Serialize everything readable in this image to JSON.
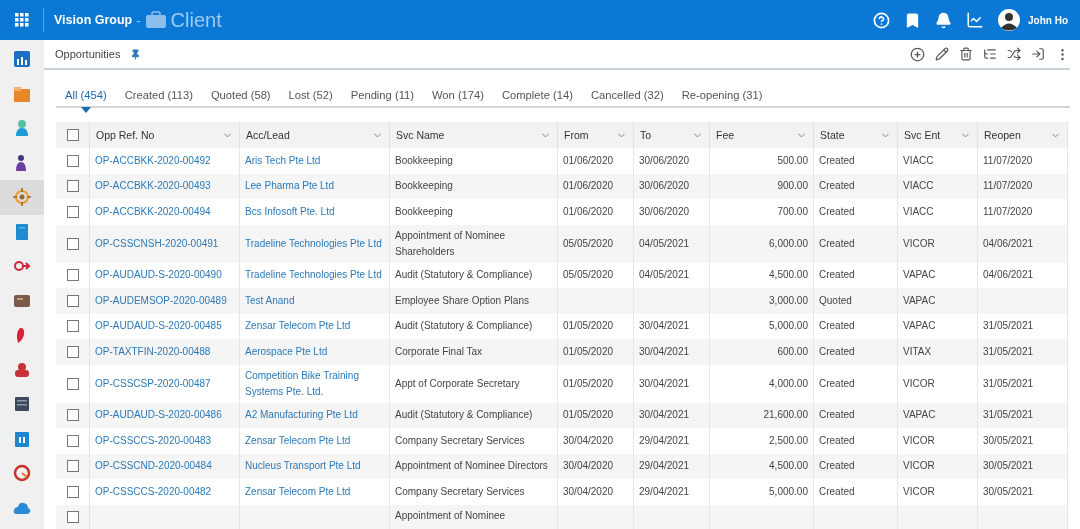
{
  "app_bar": {
    "org": "Vision Group",
    "separator": "-",
    "module": "Client",
    "user": "John Ho"
  },
  "sidebar": {
    "items": [
      {
        "selected": false
      },
      {
        "selected": false
      },
      {
        "selected": false
      },
      {
        "selected": false
      },
      {
        "selected": true
      },
      {
        "selected": false
      },
      {
        "selected": false
      },
      {
        "selected": false
      },
      {
        "selected": false
      },
      {
        "selected": false
      },
      {
        "selected": false
      },
      {
        "selected": false
      },
      {
        "selected": false
      },
      {
        "selected": false
      }
    ]
  },
  "breadcrumb": {
    "title": "Opportunities"
  },
  "tabs": [
    {
      "label": "All (454)",
      "selected": true
    },
    {
      "label": "Created (113)",
      "selected": false
    },
    {
      "label": "Quoted (58)",
      "selected": false
    },
    {
      "label": "Lost (52)",
      "selected": false
    },
    {
      "label": "Pending (11)",
      "selected": false
    },
    {
      "label": "Won (174)",
      "selected": false
    },
    {
      "label": "Complete (14)",
      "selected": false
    },
    {
      "label": "Cancelled (32)",
      "selected": false
    },
    {
      "label": "Re-opening (31)",
      "selected": false
    }
  ],
  "table": {
    "all_checked": false,
    "columns": [
      "Opp Ref. No",
      "Acc/Lead",
      "Svc Name",
      "From",
      "To",
      "Fee",
      "State",
      "Svc Ent",
      "Reopen"
    ],
    "rows": [
      {
        "checked": false,
        "cells": [
          "OP-ACCBKK-2020-00492",
          "Aris Tech Pte Ltd",
          "Bookkeeping",
          "01/06/2020",
          "30/06/2020",
          "500.00",
          "Created",
          "VIACC",
          "11/07/2020"
        ]
      },
      {
        "checked": false,
        "cells": [
          "OP-ACCBKK-2020-00493",
          "Lee Pharma Pte Ltd",
          "Bookkeeping",
          "01/06/2020",
          "30/06/2020",
          "900.00",
          "Created",
          "VIACC",
          "11/07/2020"
        ]
      },
      {
        "checked": false,
        "cells": [
          "OP-ACCBKK-2020-00494",
          "Bcs Infosoft Pte. Ltd",
          "Bookkeeping",
          "01/06/2020",
          "30/06/2020",
          "700.00",
          "Created",
          "VIACC",
          "11/07/2020"
        ]
      },
      {
        "checked": false,
        "cells": [
          "OP-CSSCNSH-2020-00491",
          "Tradeline Technologies Pte Ltd",
          "Appointment of Nominee Shareholders",
          "05/05/2020",
          "04/05/2021",
          "6,000.00",
          "Created",
          "VICOR",
          "04/06/2021"
        ]
      },
      {
        "checked": false,
        "cells": [
          "OP-AUDAUD-S-2020-00490",
          "Tradeline Technologies Pte Ltd",
          "Audit (Statutory & Compliance)",
          "05/05/2020",
          "04/05/2021",
          "4,500.00",
          "Created",
          "VAPAC",
          "04/06/2021"
        ]
      },
      {
        "checked": false,
        "cells": [
          "OP-AUDEMSOP-2020-00489",
          "Test Anand",
          "Employee Share Option Plans",
          "",
          "",
          "3,000.00",
          "Quoted",
          "VAPAC",
          ""
        ]
      },
      {
        "checked": false,
        "cells": [
          "OP-AUDAUD-S-2020-00485",
          "Zensar Telecom Pte Ltd",
          "Audit (Statutory & Compliance)",
          "01/05/2020",
          "30/04/2021",
          "5,000.00",
          "Created",
          "VAPAC",
          "31/05/2021"
        ]
      },
      {
        "checked": false,
        "cells": [
          "OP-TAXTFIN-2020-00488",
          "Aerospace Pte Ltd",
          "Corporate Final Tax",
          "01/05/2020",
          "30/04/2021",
          "600.00",
          "Created",
          "VITAX",
          "31/05/2021"
        ]
      },
      {
        "checked": false,
        "cells": [
          "OP-CSSCSP-2020-00487",
          "Competition Bike Training Systems Pte. Ltd.",
          "Appt of Corporate Secretary",
          "01/05/2020",
          "30/04/2021",
          "4,000.00",
          "Created",
          "VICOR",
          "31/05/2021"
        ]
      },
      {
        "checked": false,
        "cells": [
          "OP-AUDAUD-S-2020-00486",
          "A2 Manufacturing Pte Ltd",
          "Audit (Statutory & Compliance)",
          "01/05/2020",
          "30/04/2021",
          "21,600.00",
          "Created",
          "VAPAC",
          "31/05/2021"
        ]
      },
      {
        "checked": false,
        "cells": [
          "OP-CSSCCS-2020-00483",
          "Zensar Telecom Pte Ltd",
          "Company Secretary Services",
          "30/04/2020",
          "29/04/2021",
          "2,500.00",
          "Created",
          "VICOR",
          "30/05/2021"
        ]
      },
      {
        "checked": false,
        "cells": [
          "OP-CSSCND-2020-00484",
          "Nucleus Transport Pte Ltd",
          "Appointment of Nominee Directors",
          "30/04/2020",
          "29/04/2021",
          "4,500.00",
          "Created",
          "VICOR",
          "30/05/2021"
        ]
      },
      {
        "checked": false,
        "cells": [
          "OP-CSSCCS-2020-00482",
          "Zensar Telecom Pte Ltd",
          "Company Secretary Services",
          "30/04/2020",
          "29/04/2021",
          "5,000.00",
          "Created",
          "VICOR",
          "30/05/2021"
        ]
      },
      {
        "checked": false,
        "cells": [
          "",
          "",
          "Appointment of Nominee",
          "",
          "",
          "",
          "",
          "",
          ""
        ]
      }
    ]
  }
}
